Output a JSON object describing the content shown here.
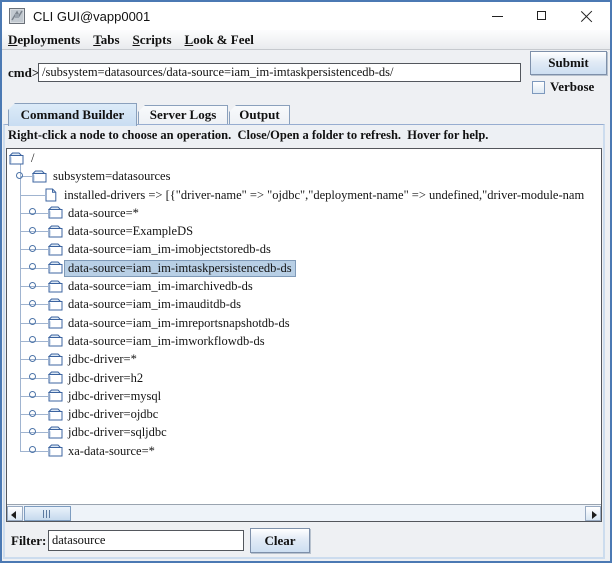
{
  "window": {
    "title": "CLI GUI@vapp0001"
  },
  "menubar": {
    "items": [
      {
        "mnemonic": "D",
        "rest": "eployments"
      },
      {
        "mnemonic": "T",
        "rest": "abs"
      },
      {
        "mnemonic": "S",
        "rest": "cripts"
      },
      {
        "mnemonic": "L",
        "rest": "ook & Feel"
      }
    ]
  },
  "command_bar": {
    "label": "cmd>",
    "value": "/subsystem=datasources/data-source=iam_im-imtaskpersistencedb-ds/",
    "submit": "Submit",
    "verbose": "Verbose",
    "verbose_checked": false
  },
  "tabs": {
    "items": [
      {
        "label": "Command Builder",
        "selected": true
      },
      {
        "label": "Server Logs",
        "selected": false
      },
      {
        "label": "Output",
        "selected": false
      }
    ]
  },
  "help_text": "Right-click a node to choose an operation.  Close/Open a folder to refresh.  Hover for help.",
  "tree": {
    "items": [
      {
        "label": "/",
        "level": 0,
        "icon": "folder",
        "handle": "none",
        "selected": false
      },
      {
        "label": "subsystem=datasources",
        "level": 1,
        "icon": "folder",
        "handle": "expanded",
        "selected": false
      },
      {
        "label": "installed-drivers => [{\"driver-name\" => \"ojdbc\",\"deployment-name\" => undefined,\"driver-module-nam",
        "level": 2,
        "icon": "document",
        "handle": "none",
        "selected": false
      },
      {
        "label": "data-source=*",
        "level": 2,
        "icon": "folder",
        "handle": "collapsed",
        "selected": false
      },
      {
        "label": "data-source=ExampleDS",
        "level": 2,
        "icon": "folder",
        "handle": "collapsed",
        "selected": false
      },
      {
        "label": "data-source=iam_im-imobjectstoredb-ds",
        "level": 2,
        "icon": "folder",
        "handle": "collapsed",
        "selected": false
      },
      {
        "label": "data-source=iam_im-imtaskpersistencedb-ds",
        "level": 2,
        "icon": "folder",
        "handle": "collapsed",
        "selected": true
      },
      {
        "label": "data-source=iam_im-imarchivedb-ds",
        "level": 2,
        "icon": "folder",
        "handle": "collapsed",
        "selected": false
      },
      {
        "label": "data-source=iam_im-imauditdb-ds",
        "level": 2,
        "icon": "folder",
        "handle": "collapsed",
        "selected": false
      },
      {
        "label": "data-source=iam_im-imreportsnapshotdb-ds",
        "level": 2,
        "icon": "folder",
        "handle": "collapsed",
        "selected": false
      },
      {
        "label": "data-source=iam_im-imworkflowdb-ds",
        "level": 2,
        "icon": "folder",
        "handle": "collapsed",
        "selected": false
      },
      {
        "label": "jdbc-driver=*",
        "level": 2,
        "icon": "folder",
        "handle": "collapsed",
        "selected": false
      },
      {
        "label": "jdbc-driver=h2",
        "level": 2,
        "icon": "folder",
        "handle": "collapsed",
        "selected": false
      },
      {
        "label": "jdbc-driver=mysql",
        "level": 2,
        "icon": "folder",
        "handle": "collapsed",
        "selected": false
      },
      {
        "label": "jdbc-driver=ojdbc",
        "level": 2,
        "icon": "folder",
        "handle": "collapsed",
        "selected": false
      },
      {
        "label": "jdbc-driver=sqljdbc",
        "level": 2,
        "icon": "folder",
        "handle": "collapsed",
        "selected": false
      },
      {
        "label": "xa-data-source=*",
        "level": 2,
        "icon": "folder",
        "handle": "collapsed",
        "selected": false
      }
    ]
  },
  "filter_bar": {
    "label": "Filter:",
    "value": "datasource",
    "clear": "Clear"
  },
  "colors": {
    "window_border": "#4b79b3",
    "selection_bg": "#b8cfe5",
    "selection_border": "#7f9ab8",
    "tab_selected_bg": "#cfe2f5",
    "tree_line": "#a0b4d0",
    "button_face": "#cddff1"
  }
}
